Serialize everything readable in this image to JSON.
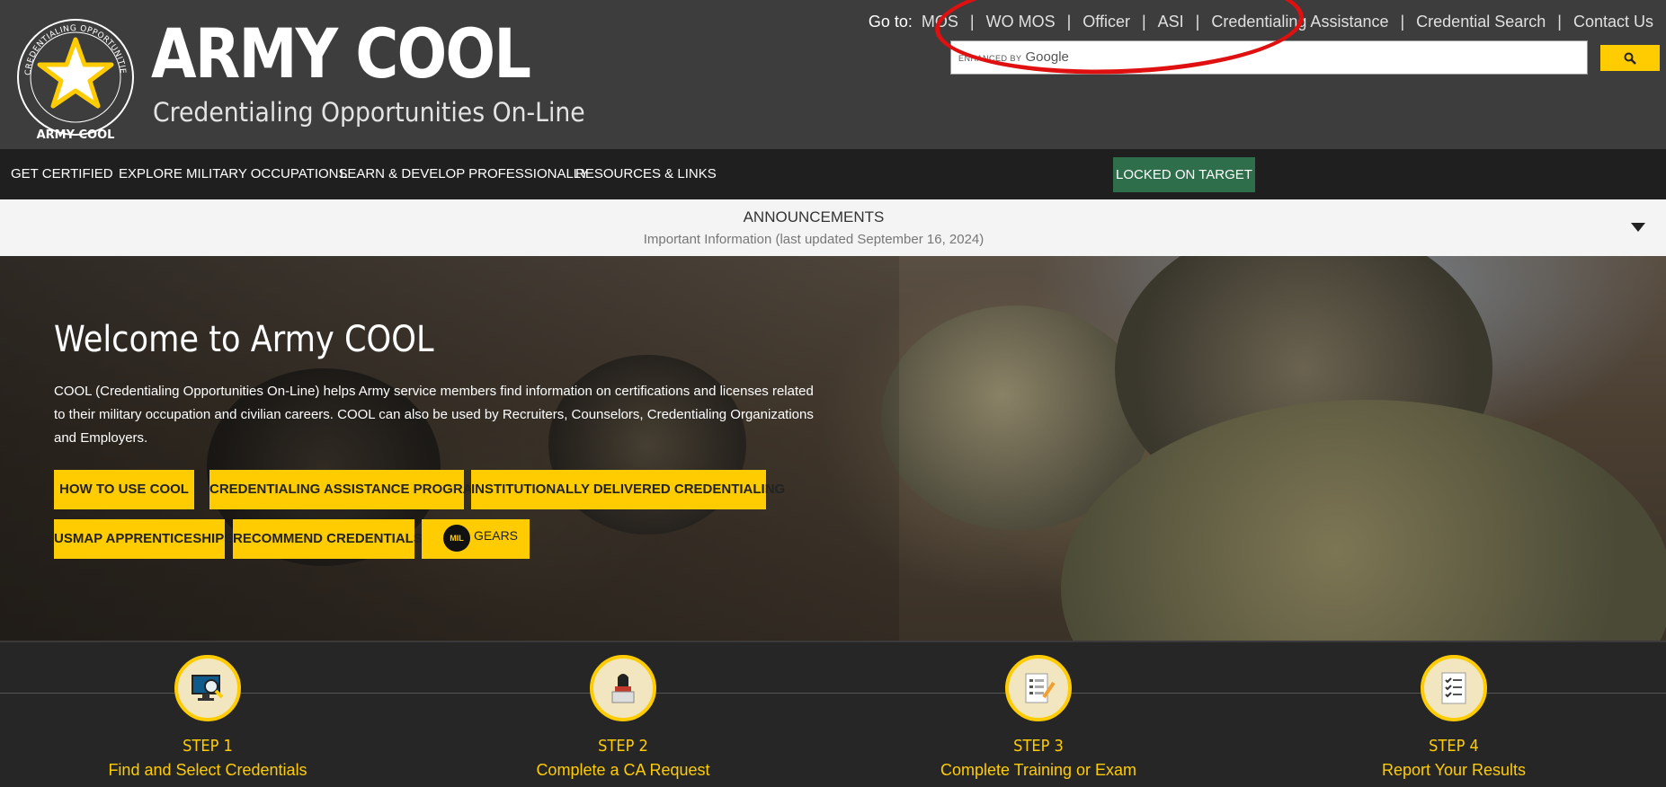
{
  "header": {
    "seal_text": "CREDENTIALING OPPORTUNITIES ON-LINE",
    "seal_bottom": "ARMY COOL",
    "title": "ARMY COOL",
    "subtitle": "Credentialing Opportunities On-Line",
    "goto_label": "Go to:",
    "goto_links": [
      "MOS",
      "WO MOS",
      "Officer",
      "ASI",
      "Credentialing Assistance",
      "Credential Search",
      "Contact Us"
    ],
    "search": {
      "brand_prefix": "ENHANCED BY",
      "brand_name": "Google",
      "placeholder": "",
      "button_icon": "search-icon"
    }
  },
  "nav": {
    "items": [
      "GET CERTIFIED",
      "EXPLORE MILITARY OCCUPATIONS",
      "LEARN & DEVELOP PROFESSIONALLY",
      "RESOURCES & LINKS"
    ],
    "locked_button": "LOCKED ON TARGET"
  },
  "announcements": {
    "title": "ANNOUNCEMENTS",
    "subtitle": "Important Information (last updated September 16, 2024)",
    "toggle_icon": "caret-down-icon"
  },
  "hero": {
    "title": "Welcome to Army COOL",
    "text": "COOL (Credentialing Opportunities On-Line) helps Army service members find information on certifications and licenses related to their military occupation and civilian careers. COOL can also be used by Recruiters, Counselors, Credentialing Organizations and Employers.",
    "buttons": [
      "HOW TO USE COOL",
      "CREDENTIALING ASSISTANCE PROGRAM",
      "INSTITUTIONALLY DELIVERED CREDENTIALING",
      "USMAP APPRENTICESHIPS",
      "RECOMMEND CREDENTIALS"
    ],
    "milgears": {
      "logo": "MIL",
      "text": "GEARS"
    }
  },
  "steps": [
    {
      "number": "STEP 1",
      "label": "Find and Select Credentials",
      "icon": "computer-search-icon"
    },
    {
      "number": "STEP 2",
      "label": "Complete a CA Request",
      "icon": "person-laptop-icon"
    },
    {
      "number": "STEP 3",
      "label": "Complete Training or Exam",
      "icon": "form-pencil-icon"
    },
    {
      "number": "STEP 4",
      "label": "Report Your Results",
      "icon": "checklist-icon"
    }
  ],
  "colors": {
    "header_bg": "#3d3d3d",
    "nav_bg": "#1f1f1f",
    "accent_yellow": "#ffcc01",
    "locked_green": "#2f6e4a",
    "annotation_red": "#e01010"
  }
}
